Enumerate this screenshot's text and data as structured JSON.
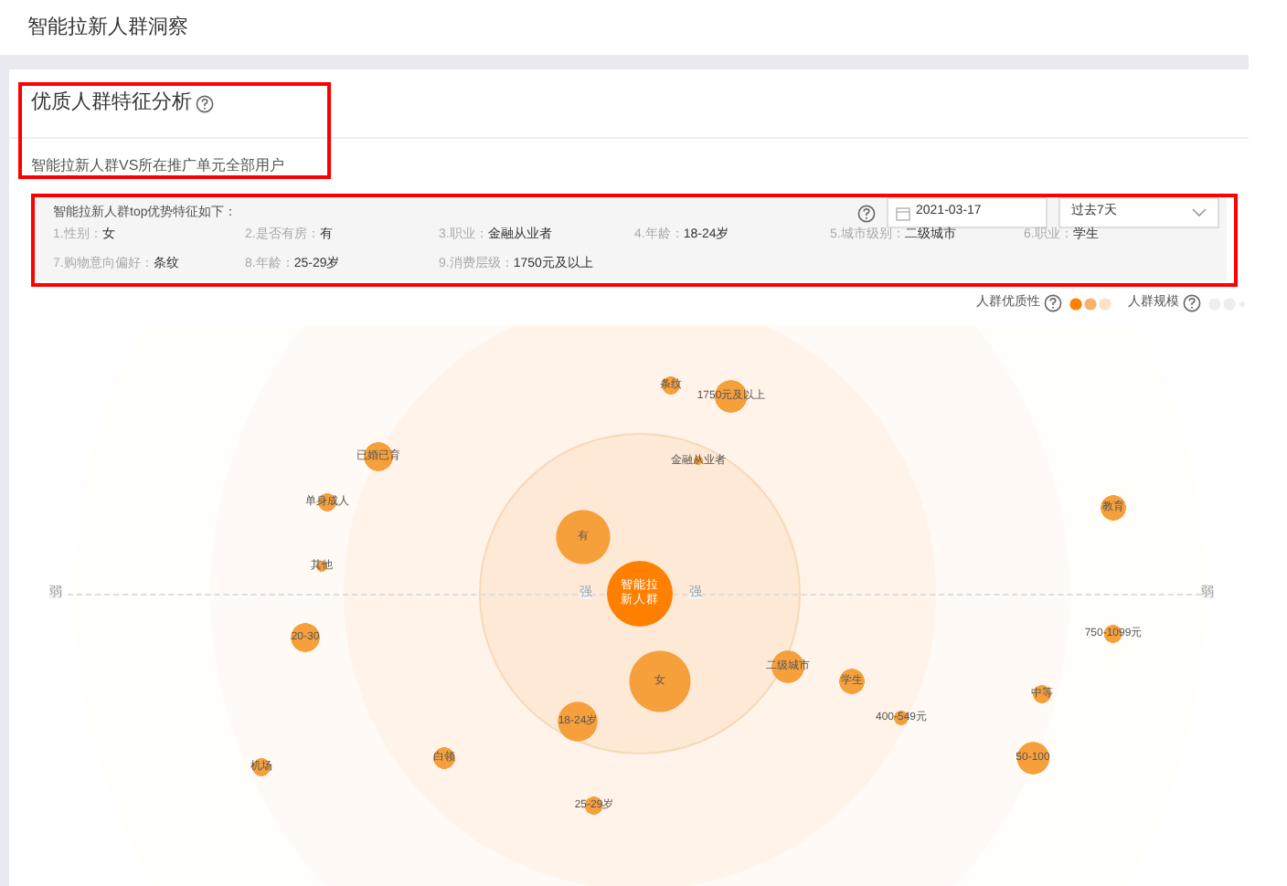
{
  "page_title": "智能拉新人群洞察",
  "card": {
    "title": "优质人群特征分析",
    "subtitle": "智能拉新人群VS所在推广单元全部用户"
  },
  "features": {
    "heading": "智能拉新人群top优势特征如下：",
    "date": "2021-03-17",
    "range": "过去7天",
    "items": [
      {
        "label": "1.性别：",
        "value": "女"
      },
      {
        "label": "2.是否有房：",
        "value": "有"
      },
      {
        "label": "3.职业：",
        "value": "金融从业者"
      },
      {
        "label": "4.年龄：",
        "value": "18-24岁"
      },
      {
        "label": "5.城市级别：",
        "value": "二级城市"
      },
      {
        "label": "6.职业：",
        "value": "学生"
      },
      {
        "label": "7.购物意向偏好：",
        "value": "条纹"
      },
      {
        "label": "8.年龄：",
        "value": "25-29岁"
      },
      {
        "label": "9.消费层级：",
        "value": "1750元及以上"
      }
    ]
  },
  "legend": {
    "quality": "人群优质性",
    "scale": "人群规模"
  },
  "chart": {
    "center": "智能拉新人群",
    "axis": [
      "弱",
      "强",
      "强",
      "弱"
    ],
    "bubbles": [
      {
        "label": "条纹"
      },
      {
        "label": "1750元及以上"
      },
      {
        "label": "已婚已育"
      },
      {
        "label": "金融从业者"
      },
      {
        "label": "单身成人"
      },
      {
        "label": "其他"
      },
      {
        "label": "有"
      },
      {
        "label": "20-30"
      },
      {
        "label": "女"
      },
      {
        "label": "二级城市"
      },
      {
        "label": "学生"
      },
      {
        "label": "400-549元"
      },
      {
        "label": "18-24岁"
      },
      {
        "label": "机场"
      },
      {
        "label": "白领"
      },
      {
        "label": "25-29岁"
      },
      {
        "label": "教育"
      },
      {
        "label": "750-1099元"
      },
      {
        "label": "中等"
      },
      {
        "label": "50-100"
      }
    ]
  }
}
